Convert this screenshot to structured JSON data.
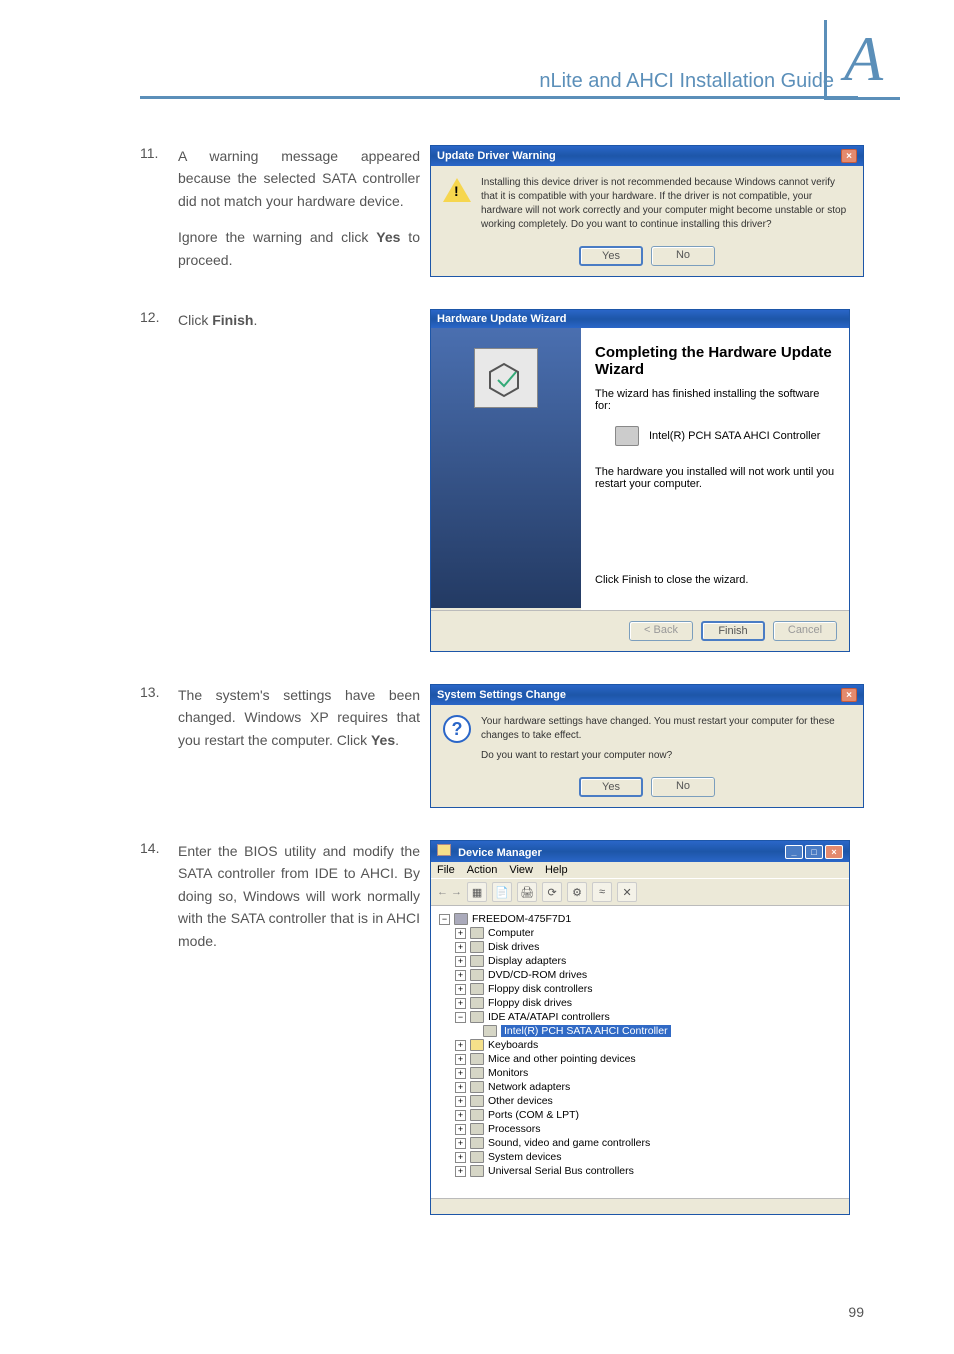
{
  "header": {
    "title": "nLite and AHCI Installation Guide",
    "appendix_letter": "A"
  },
  "steps": {
    "s11_num": "11.",
    "s11_p1": "A warning message appeared because the selected SATA controller did not match your hardware device.",
    "s11_p2_a": "Ignore the warning and click ",
    "s11_p2_b": "Yes",
    "s11_p2_c": " to proceed.",
    "s12_num": "12.",
    "s12_a": "Click ",
    "s12_b": "Finish",
    "s12_c": ".",
    "s13_num": "13.",
    "s13_a": "The system's settings have been changed. Windows XP requires that you restart the computer. Click ",
    "s13_b": "Yes",
    "s13_c": ".",
    "s14_num": "14.",
    "s14": "Enter the BIOS utility and modify the SATA controller from IDE to AHCI. By doing so, Windows will work normally with the SATA controller that is in AHCI mode."
  },
  "dialog_warn": {
    "title": "Update Driver Warning",
    "close": "×",
    "msg": "Installing this device driver is not recommended because Windows cannot verify that it is compatible with your hardware. If the driver is not compatible, your hardware will not work correctly and your computer might become unstable or stop working completely. Do you want to continue installing this driver?",
    "yes": "Yes",
    "no": "No"
  },
  "wizard": {
    "title": "Hardware Update Wizard",
    "heading": "Completing the Hardware Update Wizard",
    "line1": "The wizard has finished installing the software for:",
    "device": "Intel(R) PCH SATA AHCI Controller",
    "line2": "The hardware you installed will not work until you restart your computer.",
    "line3": "Click Finish to close the wizard.",
    "back": "< Back",
    "finish": "Finish",
    "cancel": "Cancel"
  },
  "dialog_restart": {
    "title": "System Settings Change",
    "close": "×",
    "msg1": "Your hardware settings have changed. You must restart your computer for these changes to take effect.",
    "msg2": "Do you want to restart your computer now?",
    "yes": "Yes",
    "no": "No"
  },
  "devmgr": {
    "title": "Device Manager",
    "min": "_",
    "max": "□",
    "close": "×",
    "menu_file": "File",
    "menu_action": "Action",
    "menu_view": "View",
    "menu_help": "Help",
    "tb_arrows": "← →",
    "root": "FREEDOM-475F7D1",
    "nodes": [
      "Computer",
      "Disk drives",
      "Display adapters",
      "DVD/CD-ROM drives",
      "Floppy disk controllers",
      "Floppy disk drives",
      "IDE ATA/ATAPI controllers"
    ],
    "selected": "Intel(R) PCH SATA AHCI Controller",
    "nodes2": [
      "Keyboards",
      "Mice and other pointing devices",
      "Monitors",
      "Network adapters",
      "Other devices",
      "Ports (COM & LPT)",
      "Processors",
      "Sound, video and game controllers",
      "System devices",
      "Universal Serial Bus controllers"
    ],
    "plus": "+",
    "minus": "−"
  },
  "page_number": "99"
}
